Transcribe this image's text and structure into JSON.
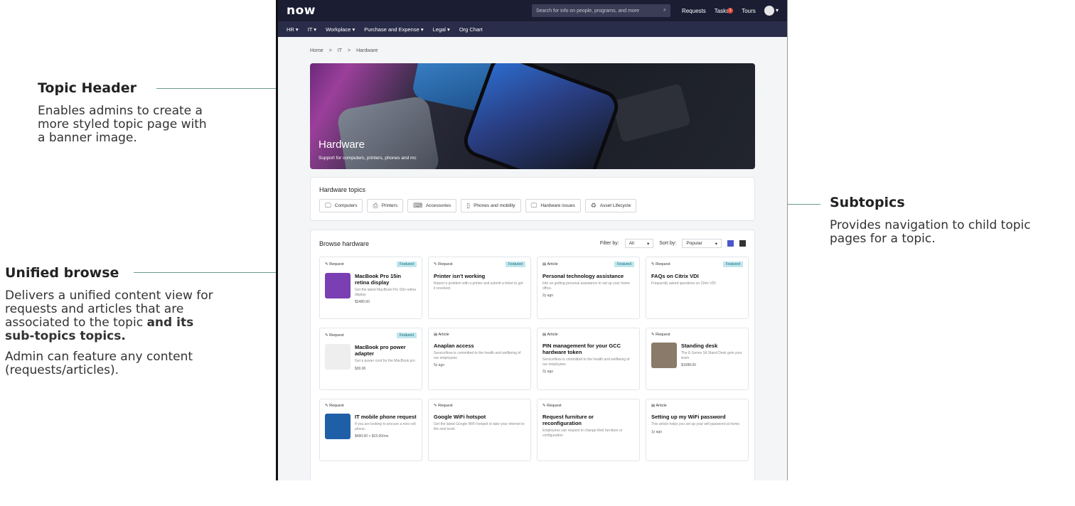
{
  "callouts": {
    "topic_header": {
      "title": "Topic Header",
      "line1": "Enables admins to create a",
      "line2": "more styled topic page with",
      "line3": "a banner image."
    },
    "unified_browse": {
      "title": "Unified browse",
      "line1": "Delivers a unified content view for",
      "line2": "requests and articles that are",
      "line3": "associated to the topic",
      "line3_bold": "and its",
      "line4_bold": "sub-topics topics.",
      "line5": "Admin can feature any content",
      "line6": "(requests/articles)."
    },
    "subtopics": {
      "title": "Subtopics",
      "line1": "Provides navigation to child topic",
      "line2": "pages for a topic."
    }
  },
  "app": {
    "logo": "now",
    "search_placeholder": "Search for info on people, programs, and more",
    "top_links": {
      "requests": "Requests",
      "tasks": "Tasks",
      "tasks_count": "3",
      "tours": "Tours"
    },
    "nav": [
      "HR ▾",
      "IT ▾",
      "Workplace ▾",
      "Purchase and Expense ▾",
      "Legal ▾",
      "Org Chart"
    ],
    "breadcrumb": [
      "Home",
      ">",
      "IT",
      ">",
      "Hardware"
    ],
    "banner": {
      "title": "Hardware",
      "subtitle": "Support for computers, printers, phones and mc"
    },
    "topics": {
      "title": "Hardware topics",
      "chips": [
        {
          "icon": "monitor-icon",
          "glyph": "🖵",
          "label": "Computers"
        },
        {
          "icon": "printer-icon",
          "glyph": "⎙",
          "label": "Printers"
        },
        {
          "icon": "keyboard-icon",
          "glyph": "⌨",
          "label": "Accessories"
        },
        {
          "icon": "phone-icon",
          "glyph": "▯",
          "label": "Phones and mobility"
        },
        {
          "icon": "hardware-issue-icon",
          "glyph": "🖵",
          "label": "Hardware issues"
        },
        {
          "icon": "recycle-icon",
          "glyph": "♻",
          "label": "Asset Lifecycle"
        }
      ]
    },
    "browse": {
      "title": "Browse hardware",
      "filter_label": "Filter by:",
      "filter_value": "All",
      "sort_label": "Sort by:",
      "sort_value": "Popular",
      "tiles": [
        {
          "type": "Request",
          "featured": "Featured",
          "title": "MacBook Pro 15in retina display",
          "desc": "Get the latest MacBook Pro 15in retina display",
          "meta": "$2480.00",
          "thumb": "#7a3fb3"
        },
        {
          "type": "Request",
          "featured": "Featured",
          "title": "Printer isn't working",
          "desc": "Report a problem with a printer and submit a ticket to get it resolved.",
          "meta": "",
          "thumb": ""
        },
        {
          "type": "Article",
          "featured": "Featured",
          "title": "Personal technology assistance",
          "desc": "Info on getting personal assistance to set up your home office.",
          "meta": "2y ago",
          "thumb": ""
        },
        {
          "type": "Request",
          "featured": "Featured",
          "title": "FAQs on Citrix VDI",
          "desc": "Frequently asked questions on Citrix VDI",
          "meta": "",
          "thumb": ""
        },
        {
          "type": "Request",
          "featured": "Featured",
          "title": "MacBook pro power adapter",
          "desc": "Get a power cord for the MacBook pro",
          "meta": "$30.00",
          "thumb": "#eeeeee"
        },
        {
          "type": "Article",
          "featured": "",
          "title": "Anaplan access",
          "desc": "ServiceNow is committed to the health and wellbeing of our employees",
          "meta": "5y ago",
          "thumb": ""
        },
        {
          "type": "Article",
          "featured": "",
          "title": "PIN management for your GCC hardware token",
          "desc": "ServiceNow is committed to the health and wellbeing of our employees",
          "meta": "2y ago",
          "thumb": ""
        },
        {
          "type": "Request",
          "featured": "",
          "title": "Standing desk",
          "desc": "The E-Series Sit Stand Desk gets your team",
          "meta": "$1088.00",
          "thumb": "#8a7a6a"
        },
        {
          "type": "Request",
          "featured": "",
          "title": "IT mobile phone request",
          "desc": "If you are looking to procure a new cell phone.",
          "meta": "$490.00 + $15.00/mo",
          "thumb": "#1f5fa8"
        },
        {
          "type": "Request",
          "featured": "",
          "title": "Google WiFi hotspot",
          "desc": "Get the latest Google WiFi hotspot to take your internet to the next level.",
          "meta": "",
          "thumb": ""
        },
        {
          "type": "Request",
          "featured": "",
          "title": "Request furniture or reconfiguration",
          "desc": "Employees can request to change their furniture or configuration",
          "meta": "",
          "thumb": ""
        },
        {
          "type": "Article",
          "featured": "",
          "title": "Setting up my WiFi password",
          "desc": "This article helps you set up your wifi password at home.",
          "meta": "1y ago",
          "thumb": ""
        }
      ]
    }
  }
}
